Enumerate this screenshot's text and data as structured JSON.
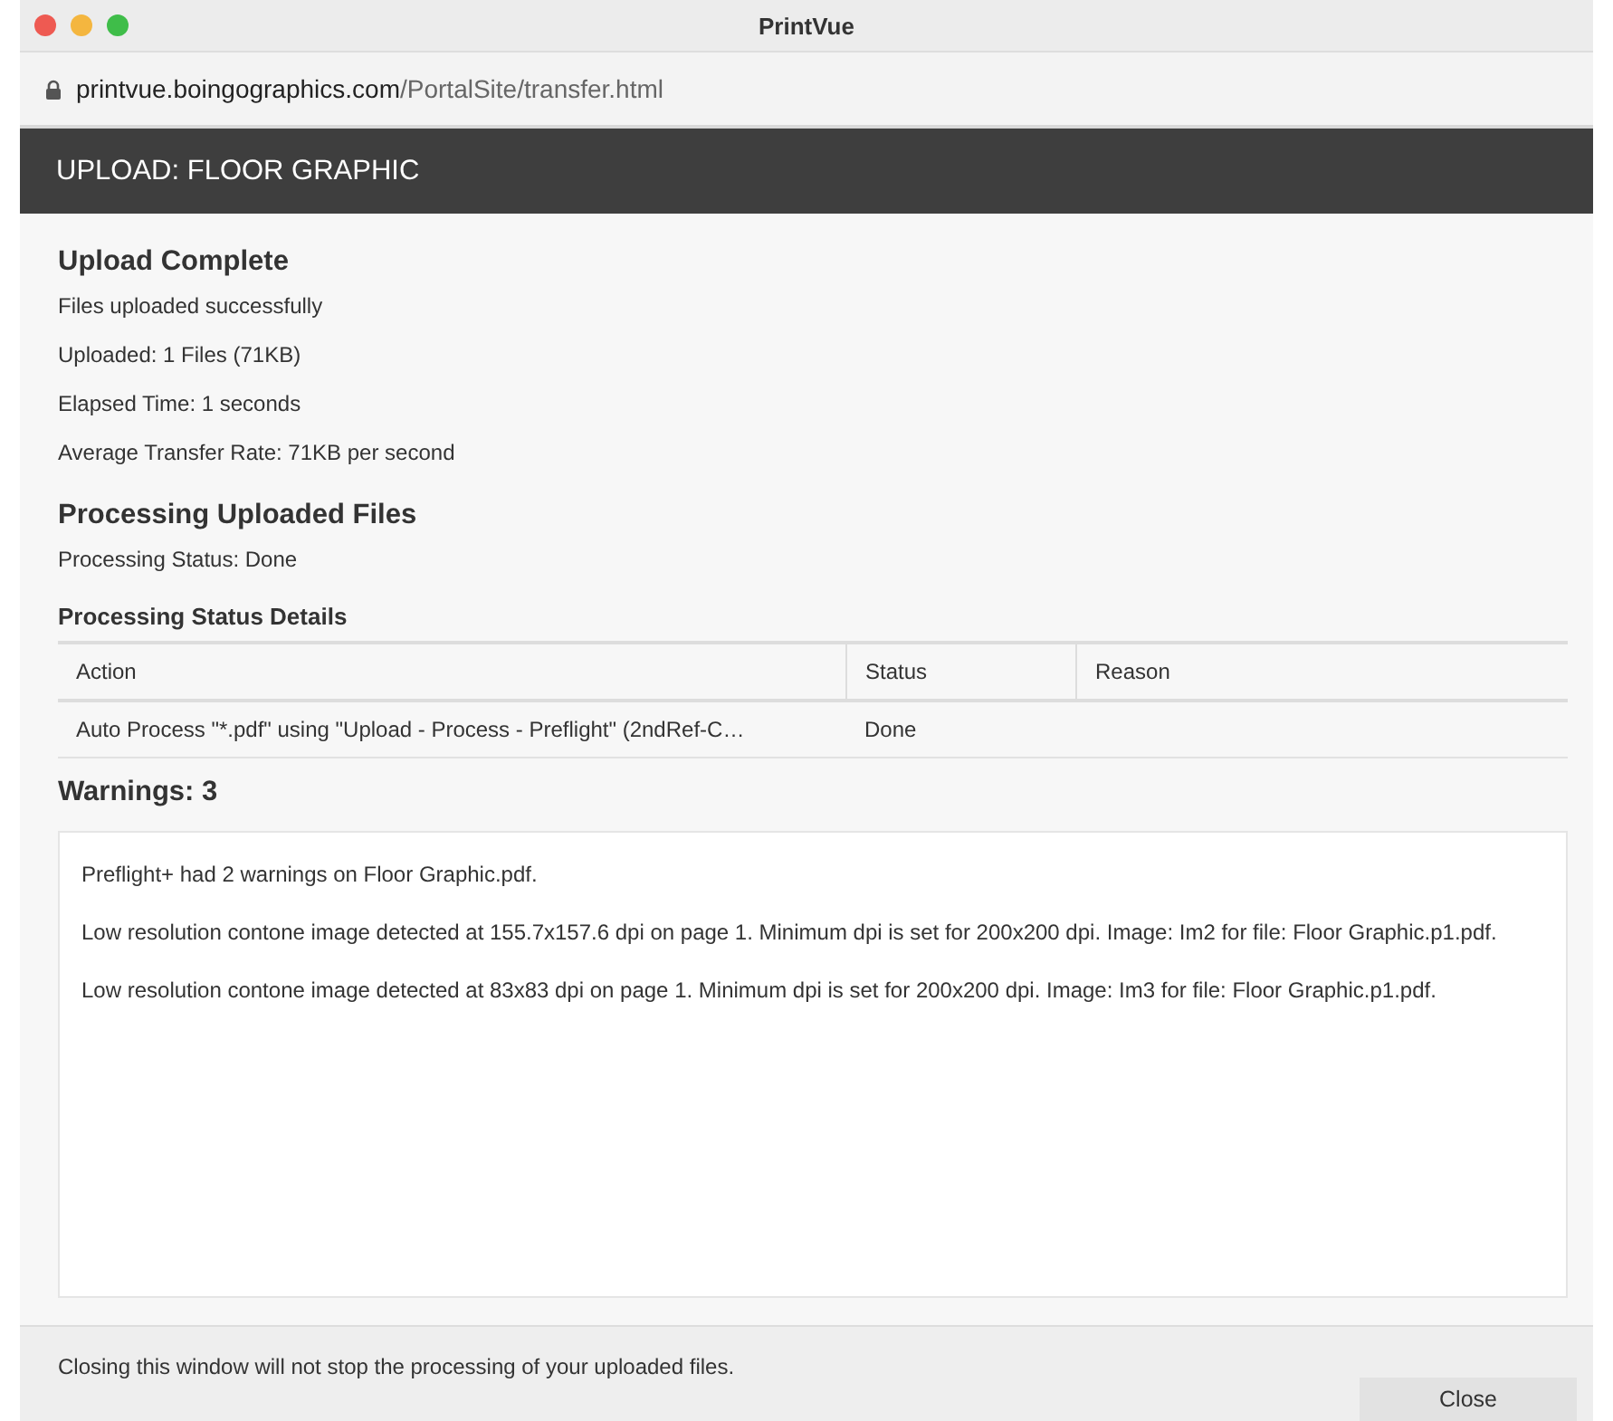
{
  "window": {
    "title": "PrintVue"
  },
  "address_bar": {
    "host": "printvue.boingographics.com",
    "path": "/PortalSite/transfer.html"
  },
  "header": {
    "title": "UPLOAD: FLOOR GRAPHIC"
  },
  "upload": {
    "heading": "Upload Complete",
    "lines": [
      "Files uploaded successfully",
      "Uploaded: 1 Files (71KB)",
      "Elapsed Time: 1 seconds",
      "Average Transfer Rate: 71KB per second"
    ]
  },
  "processing": {
    "heading": "Processing Uploaded Files",
    "status": "Processing Status: Done",
    "details_heading": "Processing Status Details"
  },
  "table": {
    "columns": [
      "Action",
      "Status",
      "Reason"
    ],
    "rows": [
      [
        "Auto Process \"*.pdf\" using \"Upload - Process - Preflight\" (2ndRef-C…",
        "Done"
      ]
    ]
  },
  "warnings": {
    "heading": "Warnings: 3",
    "messages": [
      "Preflight+ had 2 warnings on Floor Graphic.pdf.",
      "Low resolution contone image detected at 155.7x157.6 dpi on page 1. Minimum dpi is set for 200x200 dpi. Image: Im2 for file: Floor Graphic.p1.pdf.",
      "Low resolution contone image detected at 83x83 dpi on page 1. Minimum dpi is set for 200x200 dpi. Image: Im3 for file: Floor Graphic.p1.pdf."
    ]
  },
  "footer": {
    "note": "Closing this window will not stop the processing of your uploaded files.",
    "button": "Close"
  }
}
